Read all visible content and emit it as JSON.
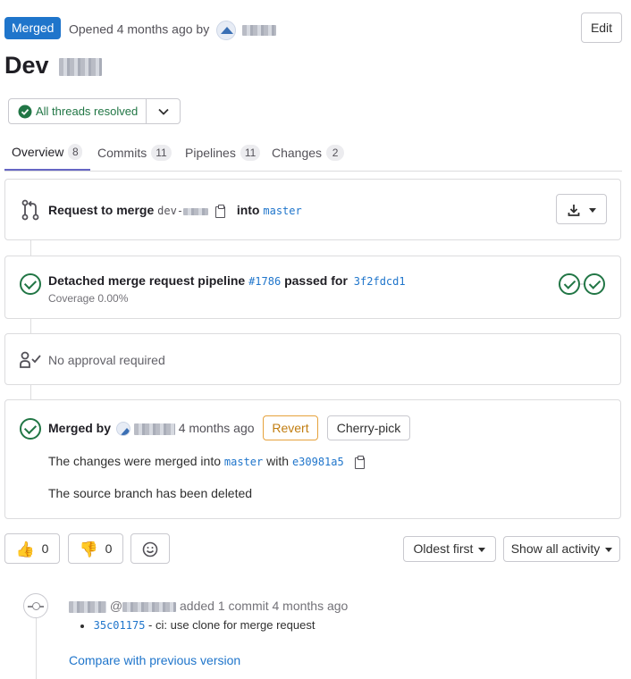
{
  "header": {
    "status_badge": "Merged",
    "opened_text": "Opened 4 months ago by",
    "edit_label": "Edit"
  },
  "title": {
    "prefix": "Dev"
  },
  "threads": {
    "label": "All threads resolved"
  },
  "tabs": [
    {
      "label": "Overview",
      "count": "8"
    },
    {
      "label": "Commits",
      "count": "11"
    },
    {
      "label": "Pipelines",
      "count": "11"
    },
    {
      "label": "Changes",
      "count": "2"
    }
  ],
  "merge_request": {
    "request_label": "Request to merge",
    "source_prefix": "dev-",
    "into_label": "into",
    "target_branch": "master"
  },
  "pipeline": {
    "text": "Detached merge request pipeline",
    "id": "#1786",
    "passed_for": "passed for",
    "commit": "3f2fdcd1",
    "coverage": "Coverage 0.00%"
  },
  "approval": {
    "text": "No approval required"
  },
  "merged": {
    "merged_by": "Merged by",
    "time": "4 months ago",
    "revert_label": "Revert",
    "cherry_pick_label": "Cherry-pick",
    "changes_text": "The changes were merged into",
    "branch": "master",
    "with": "with",
    "commit": "e30981a5",
    "deleted_text": "The source branch has been deleted"
  },
  "reactions": {
    "thumbs_up": "0",
    "thumbs_down": "0",
    "sort_label": "Oldest first",
    "filter_label": "Show all activity"
  },
  "activity": {
    "at": "@",
    "added_text": "added 1 commit 4 months ago",
    "commit_sha": "35c01175",
    "commit_msg": "- ci: use clone for merge request",
    "compare_label": "Compare with previous version"
  },
  "colors": {
    "merged_badge": "#1f75cb",
    "success": "#217645",
    "link": "#1f75cb",
    "revert": "#c17d10",
    "tab_underline": "#6666c4"
  },
  "icons": [
    "check-circle-icon",
    "chevron-down-icon",
    "merge-request-icon",
    "copy-icon",
    "download-icon",
    "approval-icon",
    "thumbs-up-icon",
    "thumbs-down-icon",
    "smiley-icon",
    "commit-icon"
  ]
}
